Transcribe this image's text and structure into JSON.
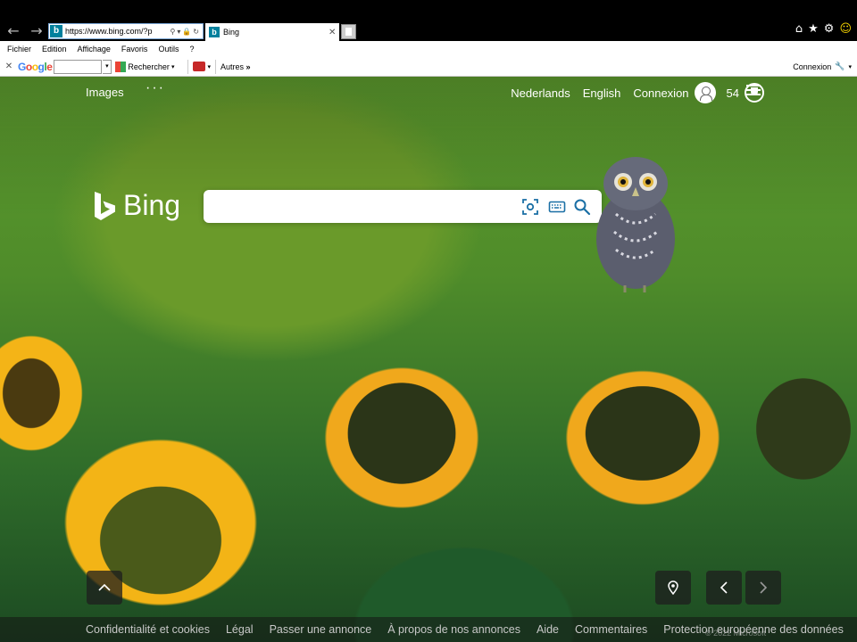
{
  "browser": {
    "url": "https://www.bing.com/?p",
    "tab_title": "Bing",
    "menu": [
      "Fichier",
      "Edition",
      "Affichage",
      "Favoris",
      "Outils",
      "?"
    ],
    "toolbar": {
      "google_search_value": "",
      "rechercher_label": "Rechercher",
      "autres_label": "Autres",
      "connexion_label": "Connexion"
    }
  },
  "bing": {
    "nav": {
      "images_label": "Images",
      "more_label": "···",
      "lang1": "Nederlands",
      "lang2": "English",
      "signin_label": "Connexion",
      "points": "54"
    },
    "logo_text": "Bing",
    "search": {
      "value": "",
      "placeholder": ""
    },
    "footer": {
      "links": [
        "Confidentialité et cookies",
        "Légal",
        "Passer une annonce",
        "À propos de nos annonces",
        "Aide",
        "Commentaires",
        "Protection européenne des données"
      ],
      "copyright": "© 2022 Microsoft"
    }
  },
  "colors": {
    "bing_teal": "#00809d",
    "footer_text": "#c8c8c8",
    "sunflower_yellow": "#f3b416",
    "foliage_green": "#4f8c2a"
  },
  "icons": [
    "back-arrow-icon",
    "forward-arrow-icon",
    "home-icon",
    "star-icon",
    "gear-icon",
    "smiley-icon",
    "visual-search-icon",
    "keyboard-icon",
    "search-icon",
    "user-icon",
    "rewards-icon",
    "hamburger-icon",
    "chevron-up-icon",
    "location-pin-icon",
    "chevron-left-icon",
    "chevron-right-icon"
  ]
}
